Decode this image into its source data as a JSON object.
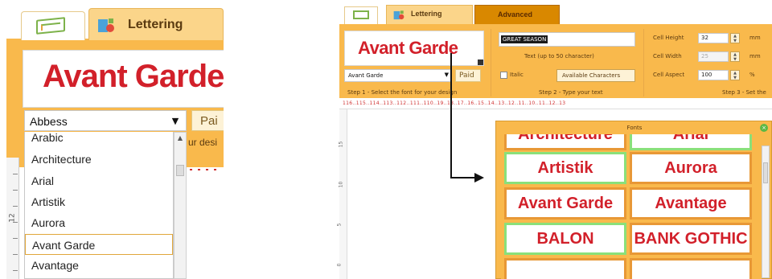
{
  "left": {
    "tab_label": "Lettering",
    "preview_text": "Avant Garde",
    "font_select_value": "Abbess",
    "paid_label": "Pai",
    "hint_fragment": "ur desi",
    "ruler_numbers": [
      "12"
    ],
    "font_list": [
      {
        "label": "Arabic",
        "selected": false
      },
      {
        "label": "Architecture",
        "selected": false
      },
      {
        "label": "Arial",
        "selected": false
      },
      {
        "label": "Artistik",
        "selected": false
      },
      {
        "label": "Aurora",
        "selected": false
      },
      {
        "label": "Avant Garde",
        "selected": true
      },
      {
        "label": "Avantage",
        "selected": false
      }
    ]
  },
  "right": {
    "tab_lettering": "Lettering",
    "tab_advanced": "Advanced",
    "preview_text": "Avant Garde",
    "font_select_value": "Avant Garde",
    "paid_label": "Paid",
    "step1": "Step 1 - Select the font for your design",
    "text_value": "GREAT SEASON",
    "text_note": "Text (up to 50 character)",
    "italic_label": "Italic",
    "available_chars": "Available Characters",
    "step2": "Step 2 - Type your text",
    "cell_height_label": "Cell Height",
    "cell_height_value": "32",
    "cell_height_unit": "mm",
    "cell_width_label": "Cell Width",
    "cell_width_value": "25",
    "cell_width_unit": "mm",
    "cell_aspect_label": "Cell Aspect",
    "cell_aspect_value": "100",
    "cell_aspect_unit": "%",
    "step3": "Step 3 - Set the",
    "ruler_h": "116..115..114..113..112..111..110..19..18..17..16..15..14..13..12..11..10..11..12..13",
    "ruler_v": [
      "15",
      "10",
      "5",
      "0"
    ],
    "fonts_dialog": {
      "title": "Fonts",
      "cells": [
        {
          "label": "Architecture",
          "green": false
        },
        {
          "label": "Arial",
          "green": true
        },
        {
          "label": "Artistik",
          "green": true
        },
        {
          "label": "Aurora",
          "green": false
        },
        {
          "label": "Avant Garde",
          "green": false
        },
        {
          "label": "Avantage",
          "green": false
        },
        {
          "label": "BALON",
          "green": true
        },
        {
          "label": "BANK GOTHIC",
          "green": false
        }
      ]
    }
  },
  "colors": {
    "orange": "#f9b94c",
    "red_text": "#d2202a",
    "tab_advanced": "#d98800",
    "green_border": "#8ae07a"
  }
}
